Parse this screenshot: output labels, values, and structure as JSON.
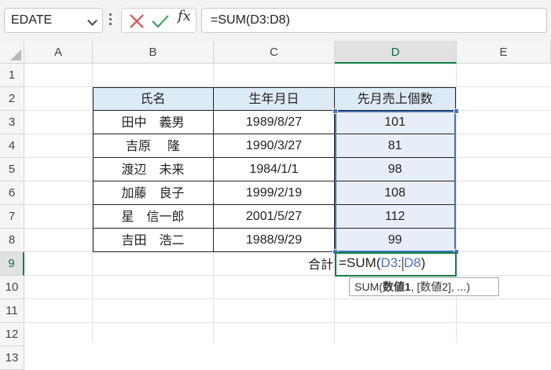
{
  "formula_bar": {
    "name_box": "EDATE",
    "cancel_icon": "close-x-icon",
    "enter_icon": "checkmark-icon",
    "fx_label": "fx",
    "formula": "=SUM(D3:D8)"
  },
  "columns": [
    "A",
    "B",
    "C",
    "D",
    "E"
  ],
  "rows": [
    "1",
    "2",
    "3",
    "4",
    "5",
    "6",
    "7",
    "8",
    "9",
    "10",
    "11",
    "12",
    "13"
  ],
  "table": {
    "headers": [
      "氏名",
      "生年月日",
      "先月売上個数"
    ],
    "rows": [
      {
        "name": "田中　義男",
        "birth": "1989/8/27",
        "sales": "101"
      },
      {
        "name": "吉原　 隆",
        "birth": "1990/3/27",
        "sales": "81"
      },
      {
        "name": "渡辺　未来",
        "birth": "1984/1/1",
        "sales": "98"
      },
      {
        "name": "加藤　良子",
        "birth": "1999/2/19",
        "sales": "108"
      },
      {
        "name": "星　信一郎",
        "birth": "2001/5/27",
        "sales": "112"
      },
      {
        "name": "吉田　浩二",
        "birth": "1988/9/29",
        "sales": "99"
      }
    ]
  },
  "total_label": "合計",
  "active_cell": {
    "prefix": "=SUM(",
    "ref_start": "D3",
    "colon": ":",
    "ref_end": "D8",
    "suffix": ")"
  },
  "tooltip": {
    "fn": "SUM(",
    "arg1": "数値1",
    "rest": ", [数値2], ...)"
  },
  "colors": {
    "header_fill": "#ddebf7",
    "selection_border": "#4472c4",
    "active_border": "#107c41"
  }
}
